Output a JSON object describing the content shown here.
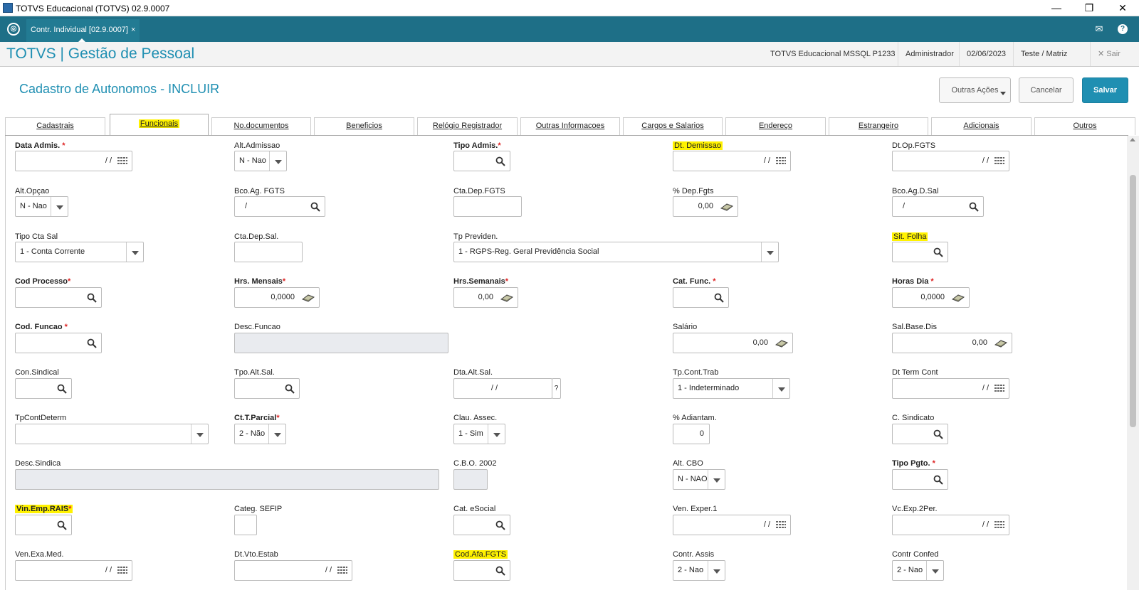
{
  "window": {
    "title": "TOTVS Educacional (TOTVS) 02.9.0007"
  },
  "apptab": {
    "label": "Contr. Individual [02.9.0007]",
    "close": "×"
  },
  "header": {
    "brand": "TOTVS | Gestão de Pessoal",
    "env": "TOTVS Educacional MSSQL P1233",
    "user": "Administrador",
    "date": "02/06/2023",
    "branch": "Teste / Matriz",
    "exit": "✕  Sair"
  },
  "form": {
    "title": "Cadastro de Autonomos - INCLUIR",
    "actions": {
      "other": "Outras Ações",
      "cancel": "Cancelar",
      "save": "Salvar"
    }
  },
  "tabs": [
    "Cadastrais",
    "Funcionais",
    "No.documentos",
    "Beneficios",
    "Relógio Registrador",
    "Outras Informacoes",
    "Cargos e Salarios",
    "Endereço",
    "Estrangeiro",
    "Adicionais",
    "Outros"
  ],
  "active_tab": "Funcionais",
  "fields": {
    "data_admis": {
      "label": "Data Admis.",
      "req": "*",
      "value": "/ /"
    },
    "alt_admissao": {
      "label": "Alt.Admissao",
      "value": "N - Nao"
    },
    "tipo_admis": {
      "label": "Tipo Admis.",
      "req": "*"
    },
    "dt_demissao": {
      "label": "Dt. Demissao",
      "value": "/ /"
    },
    "dt_op_fgts": {
      "label": "Dt.Op.FGTS",
      "value": "/ /"
    },
    "alt_opcao": {
      "label": "Alt.Opçao",
      "value": "N - Nao"
    },
    "bco_ag_fgts": {
      "label": "Bco.Ag. FGTS",
      "value": "/"
    },
    "cta_dep_fgts": {
      "label": "Cta.Dep.FGTS"
    },
    "pct_dep_fgts": {
      "label": "% Dep.Fgts",
      "value": "0,00"
    },
    "bco_ag_d_sal": {
      "label": "Bco.Ag.D.Sal",
      "value": "/"
    },
    "tipo_cta_sal": {
      "label": "Tipo Cta Sal",
      "value": "1 - Conta Corrente"
    },
    "cta_dep_sal": {
      "label": "Cta.Dep.Sal."
    },
    "tp_previden": {
      "label": "Tp Previden.",
      "value": "1 - RGPS-Reg. Geral Previdência Social"
    },
    "sit_folha": {
      "label": "Sit. Folha"
    },
    "cod_processo": {
      "label": "Cod Processo",
      "req": "*"
    },
    "hrs_mensais": {
      "label": "Hrs. Mensais",
      "req": "*",
      "value": "0,0000"
    },
    "hrs_semanais": {
      "label": "Hrs.Semanais",
      "req": "*",
      "value": "0,00"
    },
    "cat_func": {
      "label": "Cat. Func.",
      "req": "*"
    },
    "horas_dia": {
      "label": "Horas Dia",
      "req": "*",
      "value": "0,0000"
    },
    "cod_funcao": {
      "label": "Cod. Funcao",
      "req": "*"
    },
    "desc_funcao": {
      "label": "Desc.Funcao"
    },
    "salario": {
      "label": "Salário",
      "value": "0,00"
    },
    "sal_base_dis": {
      "label": "Sal.Base.Dis",
      "value": "0,00"
    },
    "con_sindical": {
      "label": "Con.Sindical"
    },
    "tpo_alt_sal": {
      "label": "Tpo.Alt.Sal."
    },
    "dta_alt_sal": {
      "label": "Dta.Alt.Sal.",
      "value": "/ /",
      "help": "?"
    },
    "tp_cont_trab": {
      "label": "Tp.Cont.Trab",
      "value": "1 - Indeterminado"
    },
    "dt_term_cont": {
      "label": "Dt Term Cont",
      "value": "/ /"
    },
    "tp_cont_determ": {
      "label": "TpContDeterm"
    },
    "ct_t_parcial": {
      "label": "Ct.T.Parcial",
      "req": "*",
      "value": "2 - Não"
    },
    "clau_assec": {
      "label": "Clau. Assec.",
      "value": "1 - Sim"
    },
    "pct_adiantam": {
      "label": "% Adiantam.",
      "value": "0"
    },
    "c_sindicato": {
      "label": "C. Sindicato"
    },
    "desc_sindica": {
      "label": "Desc.Sindica"
    },
    "cbo_2002": {
      "label": "C.B.O. 2002"
    },
    "alt_cbo": {
      "label": "Alt. CBO",
      "value": "N - NAO"
    },
    "tipo_pgto": {
      "label": "Tipo Pgto.",
      "req": "*"
    },
    "vin_emp_rais": {
      "label": "Vin.Emp.RAIS",
      "req": "*"
    },
    "categ_sefip": {
      "label": "Categ. SEFIP"
    },
    "cat_esocial": {
      "label": "Cat. eSocial"
    },
    "ven_exper_1": {
      "label": "Ven. Exper.1",
      "value": "/ /"
    },
    "vc_exp_2per": {
      "label": "Vc.Exp.2Per.",
      "value": "/ /"
    },
    "ven_exa_med": {
      "label": "Ven.Exa.Med.",
      "value": "/ /"
    },
    "dt_vto_estab": {
      "label": "Dt.Vto.Estab",
      "value": "/ /"
    },
    "cod_afa_fgts": {
      "label": "Cod.Afa.FGTS"
    },
    "contr_assis": {
      "label": "Contr. Assis",
      "value": "2 - Nao"
    },
    "contr_confed": {
      "label": "Contr Confed",
      "value": "2 - Nao"
    }
  },
  "highlight_color": "#fff200",
  "accent_color": "#1f8fb2"
}
